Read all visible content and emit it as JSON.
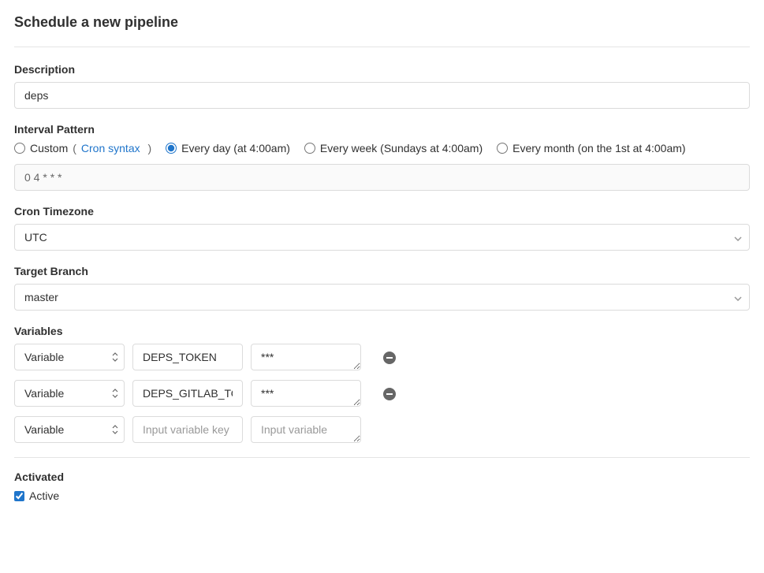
{
  "page_title": "Schedule a new pipeline",
  "description": {
    "label": "Description",
    "value": "deps"
  },
  "interval": {
    "label": "Interval Pattern",
    "options": {
      "custom": "Custom",
      "cron_link": "Cron syntax",
      "every_day": "Every day (at 4:00am)",
      "every_week": "Every week (Sundays at 4:00am)",
      "every_month": "Every month (on the 1st at 4:00am)"
    },
    "selected": "every_day",
    "cron_value": "0 4 * * *"
  },
  "timezone": {
    "label": "Cron Timezone",
    "value": "UTC"
  },
  "target_branch": {
    "label": "Target Branch",
    "value": "master"
  },
  "variables": {
    "label": "Variables",
    "type_option": "Variable",
    "rows": [
      {
        "key": "DEPS_TOKEN",
        "value": "***"
      },
      {
        "key": "DEPS_GITLAB_TOKEN",
        "value": "***"
      }
    ],
    "placeholder_key": "Input variable key",
    "placeholder_value": "Input variable"
  },
  "activated": {
    "label": "Activated",
    "checkbox_label": "Active",
    "checked": true
  }
}
